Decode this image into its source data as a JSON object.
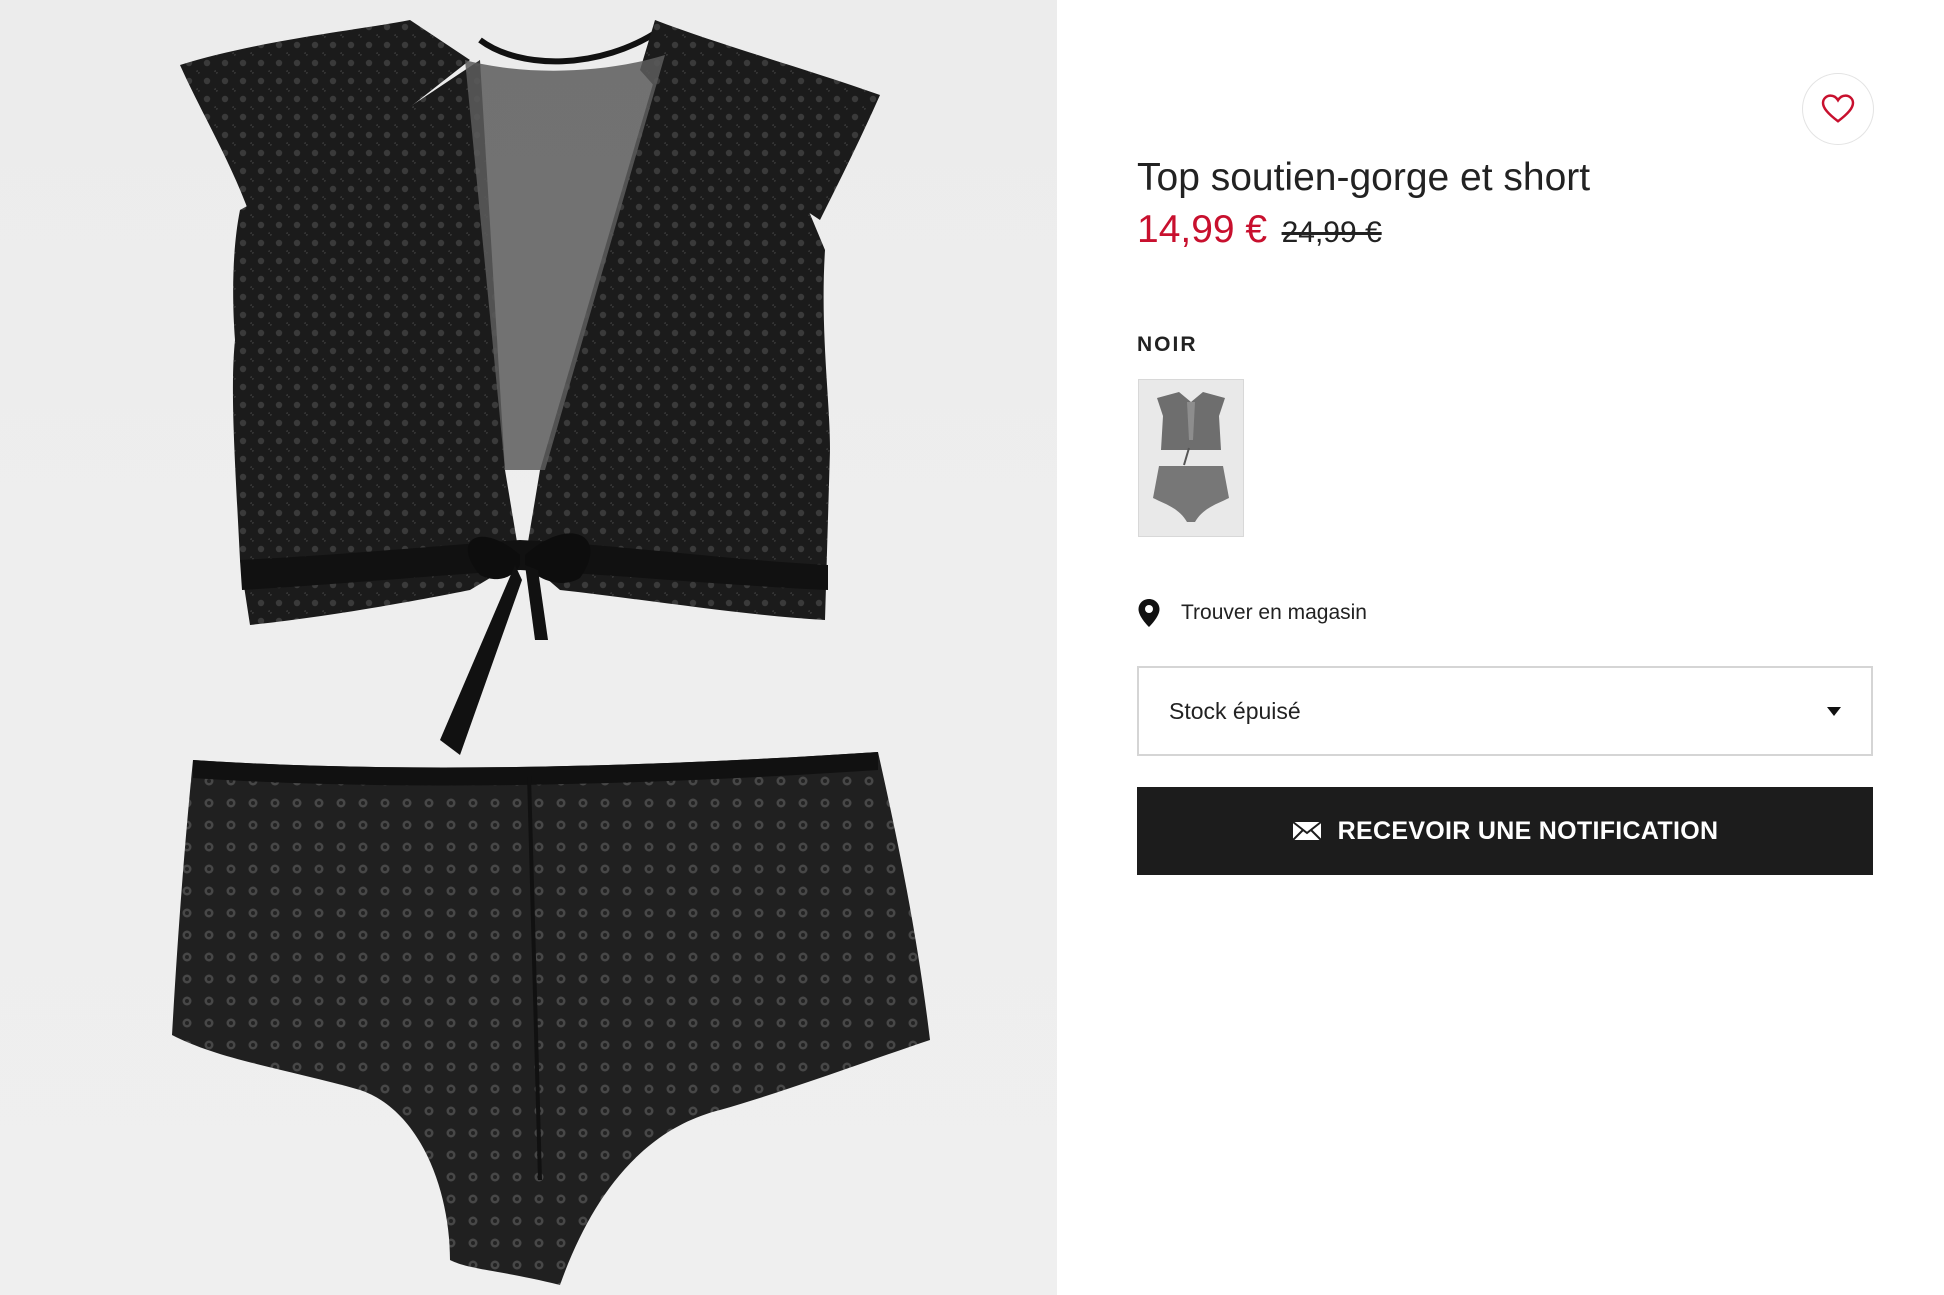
{
  "product": {
    "title": "Top soutien-gorge et short",
    "price_current": "14,99 €",
    "price_old": "24,99 €",
    "color_name": "NOIR"
  },
  "store": {
    "label": "Trouver en magasin"
  },
  "size_select": {
    "value": "Stock épuisé"
  },
  "notify": {
    "label": "RECEVOIR UNE NOTIFICATION"
  },
  "colors": {
    "accent_price": "#c8102e",
    "button_bg": "#1c1c1c",
    "favorite_heart": "#c8102e"
  },
  "icons": {
    "favorite": "heart-icon",
    "store": "location-pin-icon",
    "dropdown": "caret-down-icon",
    "notify": "envelope-icon"
  }
}
